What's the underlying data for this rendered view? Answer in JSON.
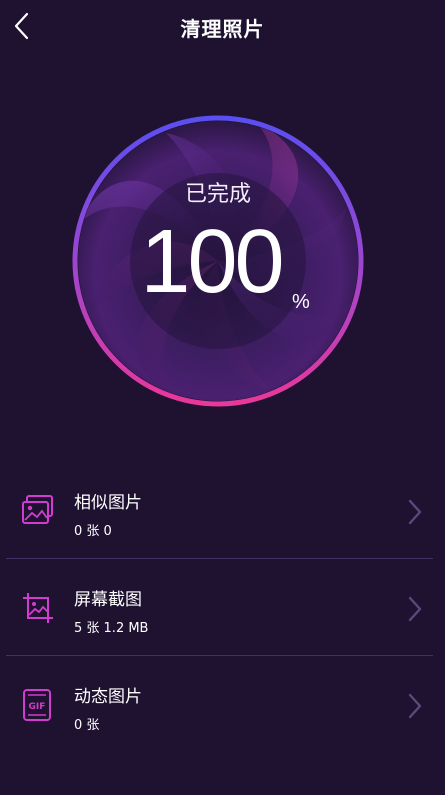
{
  "header": {
    "title": "清理照片",
    "back_icon": "chevron-left-icon"
  },
  "progress": {
    "status": "已完成",
    "value": "100",
    "unit": "%",
    "fraction": 1.0
  },
  "categories": [
    {
      "label": "相似图片",
      "detail": "0 张 0",
      "icon": "images-stack-icon"
    },
    {
      "label": "屏幕截图",
      "detail": "5 张 1.2 MB",
      "icon": "screenshot-crop-icon"
    },
    {
      "label": "动态图片",
      "detail": "0 张",
      "icon": "gif-file-icon"
    }
  ],
  "colors": {
    "background": "#1e1230",
    "ring_top": "#5b4ef0",
    "ring_bottom": "#e8379a",
    "icon_accent": "#d23bd0"
  }
}
